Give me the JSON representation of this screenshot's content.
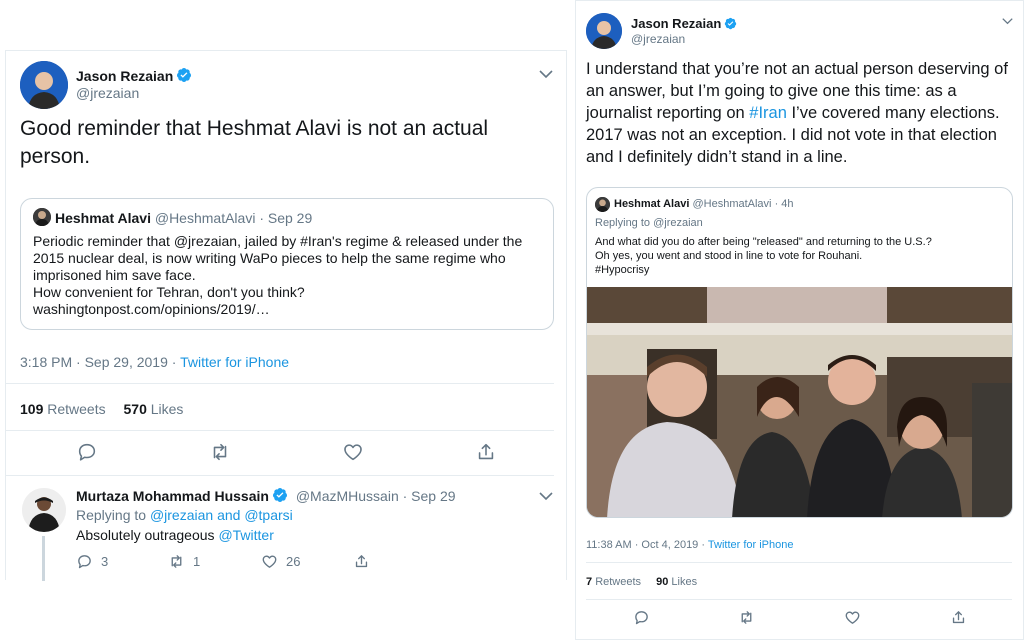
{
  "colors": {
    "link": "#1b95e0",
    "muted": "#657786",
    "text": "#14171a",
    "border": "#e6ecf0",
    "verified": "#1da1f2"
  },
  "left_tweet": {
    "author_name": "Jason Rezaian",
    "author_handle": "@jrezaian",
    "text": "Good reminder that Heshmat Alavi is not an actual person.",
    "quoted": {
      "author_name": "Heshmat Alavi",
      "author_handle": "@HeshmatAlavi",
      "date": "· Sep 29",
      "text_lines": [
        "Periodic reminder that @jrezaian, jailed by #Iran's regime & released under the 2015 nuclear deal, is now writing WaPo pieces to help the same regime who imprisoned him save face.",
        "How convenient for Tehran, don't you think?",
        "washingtonpost.com/opinions/2019/…"
      ]
    },
    "timestamp": "3:18 PM · Sep 29, 2019 · ",
    "source": "Twitter for iPhone",
    "retweets_count": "109",
    "retweets_label": "Retweets",
    "likes_count": "570",
    "likes_label": "Likes",
    "actions": [
      "reply-icon",
      "retweet-icon",
      "like-icon",
      "share-icon"
    ]
  },
  "reply_tweet": {
    "author_name": "Murtaza Mohammad Hussain",
    "author_handle": "@MazMHussain",
    "date": "· Sep 29",
    "replying_prefix": "Replying to ",
    "replying_users": "@jrezaian and @tparsi",
    "text": "Absolutely outrageous ",
    "mention": "@Twitter",
    "reply_count": "3",
    "retweet_count": "1",
    "like_count": "26"
  },
  "right_tweet": {
    "author_name": "Jason Rezaian",
    "author_handle": "@jrezaian",
    "text_before": "I understand that you’re not an actual person deserving of an answer, but I’m going to give one this time: as a journalist reporting on ",
    "hashtag": "#Iran",
    "text_after": " I’ve covered many elections. 2017 was not an exception. I did not vote in that election and I definitely didn’t stand in a line.",
    "quoted": {
      "author_name": "Heshmat Alavi",
      "author_handle": "@HeshmatAlavi",
      "date": "· 4h",
      "replying": "Replying to @jrezaian",
      "lines": [
        "And what did you do after being \"released\" and returning to the U.S.?",
        "Oh yes, you went and stood in line to vote for Rouhani.",
        "#Hypocrisy"
      ]
    },
    "timestamp": "11:38 AM · Oct 4, 2019 · ",
    "source": "Twitter for iPhone",
    "retweets_count": "7",
    "retweets_label": "Retweets",
    "likes_count": "90",
    "likes_label": "Likes"
  }
}
